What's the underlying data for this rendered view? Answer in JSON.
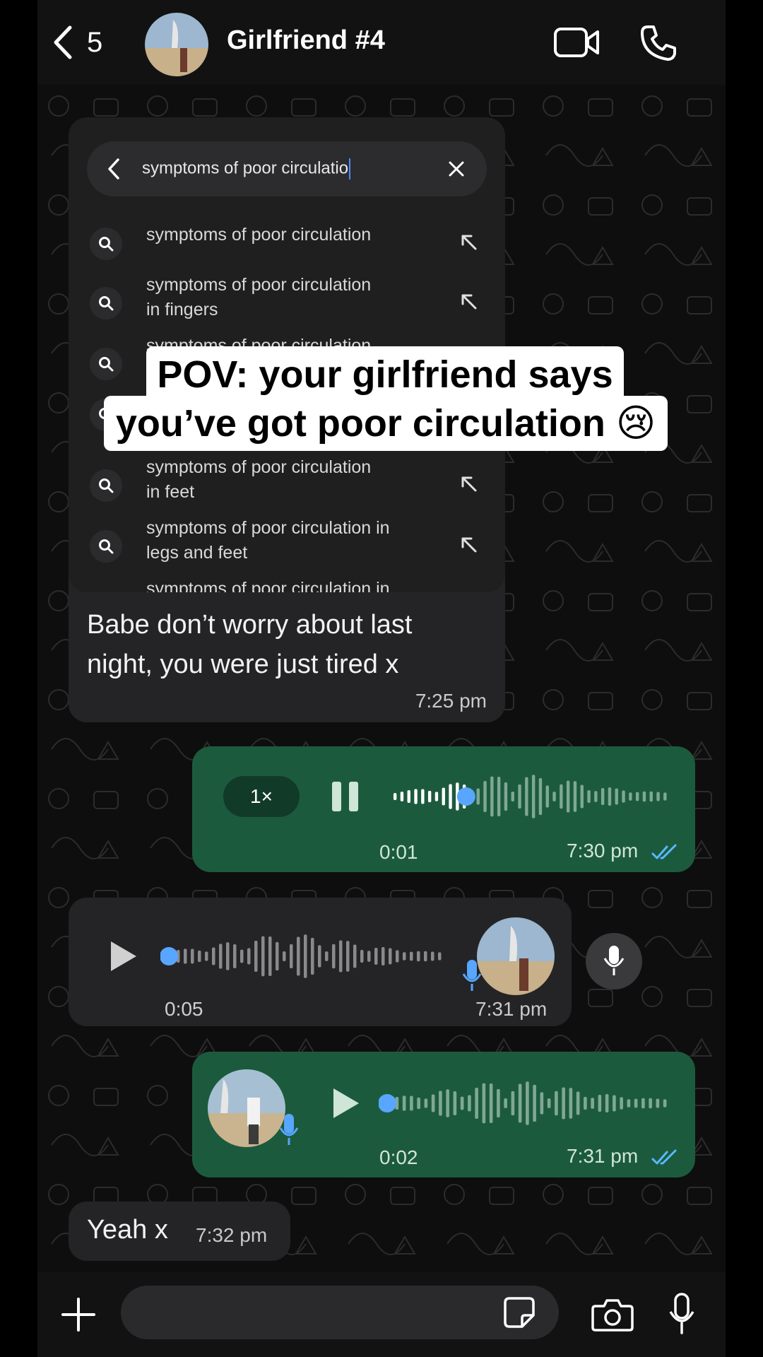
{
  "header": {
    "back_count": "5",
    "contact_name": "Girlfriend #4",
    "icons": [
      "chevron-left-icon",
      "video-call-icon",
      "phone-call-icon"
    ]
  },
  "search": {
    "query": "symptoms of poor circulatio",
    "suggestions": [
      {
        "line1": "symptoms of poor circulation",
        "line2": ""
      },
      {
        "line1": "symptoms of poor circulation",
        "line2": "in fingers"
      },
      {
        "line1": "symptoms of poor circulation",
        "line2": "i"
      },
      {
        "line1": "symptoms of poor circulation",
        "line2": "in feet"
      },
      {
        "line1": "symptoms of poor circulation in",
        "line2": "legs and feet"
      },
      {
        "line1": "symptoms of poor circulation in",
        "line2": ""
      }
    ]
  },
  "caption": {
    "line1": "POV: your girlfriend says",
    "line2": "you’ve got poor circulation 😢"
  },
  "messages": {
    "m1": {
      "text_line1": "Babe don’t worry about last",
      "text_line2": "night, you were just tired x",
      "time": "7:25 pm"
    },
    "m2": {
      "speed": "1×",
      "duration": "0:01",
      "time": "7:30 pm",
      "progress": 0.27
    },
    "m3": {
      "duration": "0:05",
      "time": "7:31 pm",
      "progress": 0.0
    },
    "m4": {
      "duration": "0:02",
      "time": "7:31 pm",
      "progress": 0.0
    },
    "m5": {
      "text": "Yeah x",
      "time": "7:32 pm"
    }
  },
  "colors": {
    "outgoing_bubble": "#1c5a3e",
    "incoming_bubble": "#242426",
    "accent_blue": "#58a6ff",
    "read_ticks": "#58b8ff"
  }
}
